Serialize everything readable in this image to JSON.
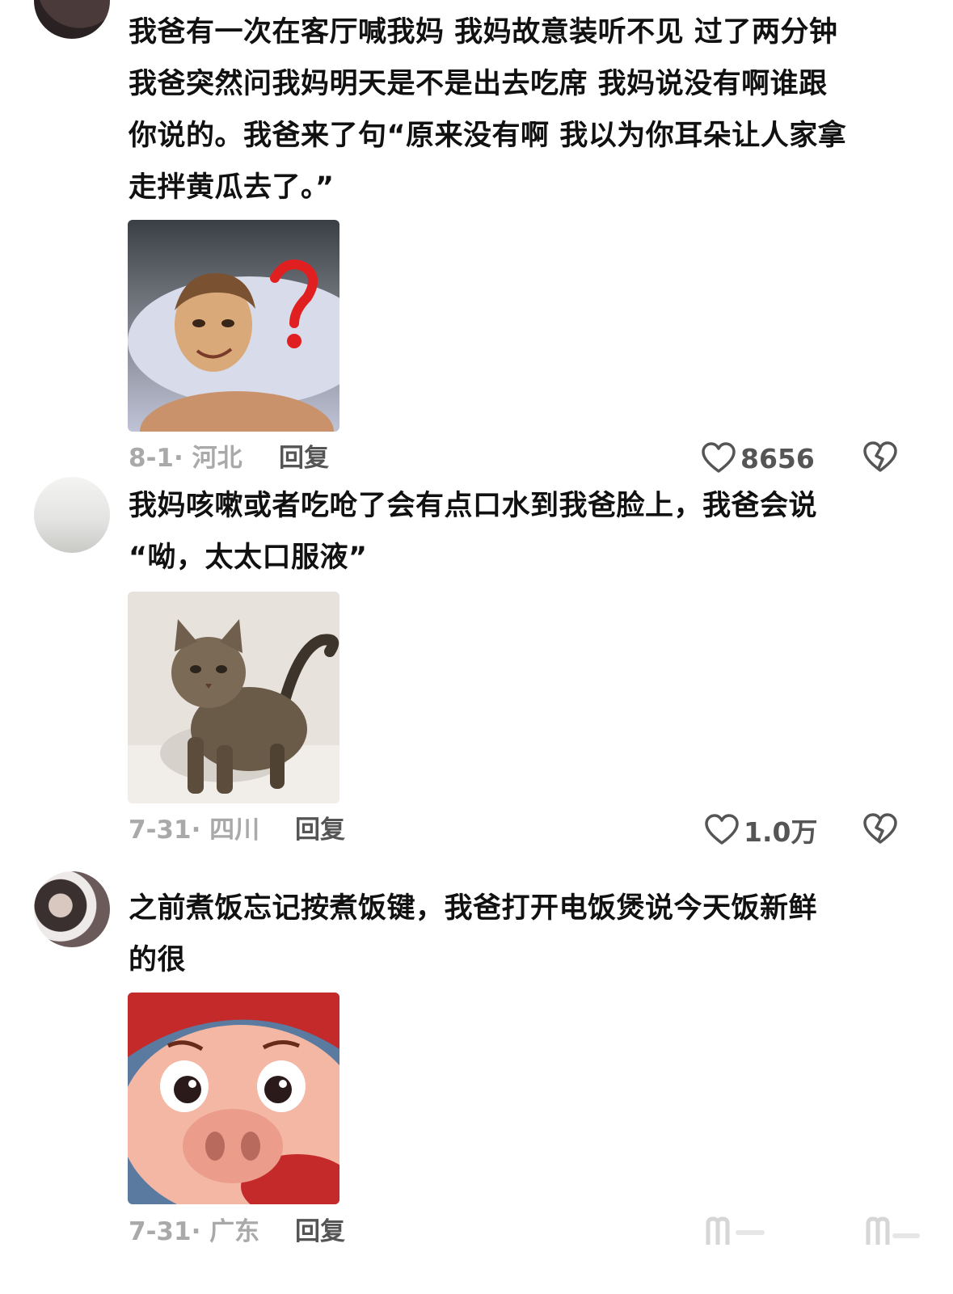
{
  "comments": [
    {
      "text": "我爸有一次在客厅喊我妈 我妈故意装听不见 过了两分钟\n我爸突然问我妈明天是不是出去吃席 我妈说没有啊谁跟\n你说的。我爸来了句“原来没有啊 我以为你耳朵让人家拿\n走拌黄瓜去了。”",
      "image": "meme-man-with-question-mark",
      "date_loc": "8-1· 河北",
      "reply_label": "回复",
      "likes": "8656"
    },
    {
      "text": "我妈咳嗽或者吃呛了会有点口水到我爸脸上，我爸会说\n“呦，太太口服液”",
      "image": "blurry-cat",
      "date_loc": "7-31· 四川",
      "reply_label": "回复",
      "likes": "1.0万"
    },
    {
      "text": "之前煮饭忘记按煮饭键，我爸打开电饭煲说今天饭新鲜\n的很",
      "image": "cartoon-pig-face",
      "date_loc": "7-31· 广东",
      "reply_label": "回复",
      "likes": ""
    }
  ],
  "icons": {
    "like": "heart-outline-icon",
    "dislike": "broken-heart-icon"
  },
  "colors": {
    "text": "#111111",
    "meta": "#a9a9a9",
    "icon": "#555555"
  }
}
